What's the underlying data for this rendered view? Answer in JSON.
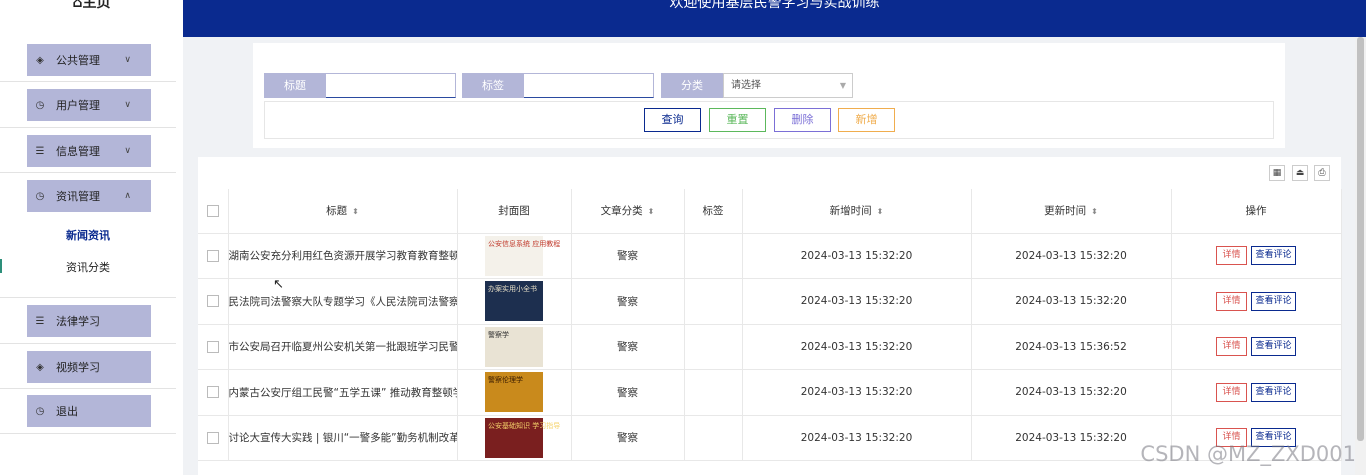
{
  "header": {
    "home_label": "⌂主页",
    "welcome": "欢迎使用基层民警学习与实战训练"
  },
  "sidebar": {
    "items": [
      {
        "label": "公共管理",
        "icon": "layers-icon",
        "chevron": "∨"
      },
      {
        "label": "用户管理",
        "icon": "clock-icon",
        "chevron": "∨"
      },
      {
        "label": "信息管理",
        "icon": "list-icon",
        "chevron": "∨"
      },
      {
        "label": "资讯管理",
        "icon": "clock-icon",
        "chevron": "∧"
      },
      {
        "label": "法律学习",
        "icon": "list-icon"
      },
      {
        "label": "视频学习",
        "icon": "layers-icon"
      },
      {
        "label": "退出",
        "icon": "clock-icon"
      }
    ],
    "sub_items": [
      {
        "label": "新闻资讯",
        "active": true
      },
      {
        "label": "资讯分类",
        "active": false
      }
    ]
  },
  "search": {
    "title_label": "标题",
    "tag_label": "标签",
    "category_label": "分类",
    "category_value": "请选择",
    "buttons": {
      "query": "查询",
      "reset": "重置",
      "delete": "删除",
      "add": "新增"
    }
  },
  "table": {
    "headers": {
      "title": "标题",
      "cover": "封面图",
      "category": "文章分类",
      "tag": "标签",
      "created": "新增时间",
      "updated": "更新时间",
      "ops": "操作"
    },
    "sort_icon": "⬍",
    "actions": {
      "detail": "详情",
      "comments": "查看评论"
    },
    "rows": [
      {
        "title": "湖南公安充分利用红色资源开展学习教育教育整顿",
        "cover_text": "公安信息系统\n应用教程",
        "category": "警察",
        "tag": "",
        "created": "2024-03-13 15:32:20",
        "updated": "2024-03-13 15:32:20"
      },
      {
        "title": "民法院司法警察大队专题学习《人民法院司法警察内",
        "cover_text": "办案实用小全书",
        "category": "警察",
        "tag": "",
        "created": "2024-03-13 15:32:20",
        "updated": "2024-03-13 15:32:20"
      },
      {
        "title": "市公安局召开临夏州公安机关第一批跟班学习民警对",
        "cover_text": "警察学",
        "category": "警察",
        "tag": "",
        "created": "2024-03-13 15:32:20",
        "updated": "2024-03-13 15:36:52"
      },
      {
        "title": "内蒙古公安厅组工民警“五学五课” 推动教育整顿学习",
        "cover_text": "警察伦理学",
        "category": "警察",
        "tag": "",
        "created": "2024-03-13 15:32:20",
        "updated": "2024-03-13 15:32:20"
      },
      {
        "title": "讨论大宣传大实践 | 银川“一警多能”勤务机制改革盘活",
        "cover_text": "公安基础知识\n学习指导",
        "category": "警察",
        "tag": "",
        "created": "2024-03-13 15:32:20",
        "updated": "2024-03-13 15:32:20"
      }
    ]
  },
  "watermark": "CSDN @MZ_ZXD001"
}
